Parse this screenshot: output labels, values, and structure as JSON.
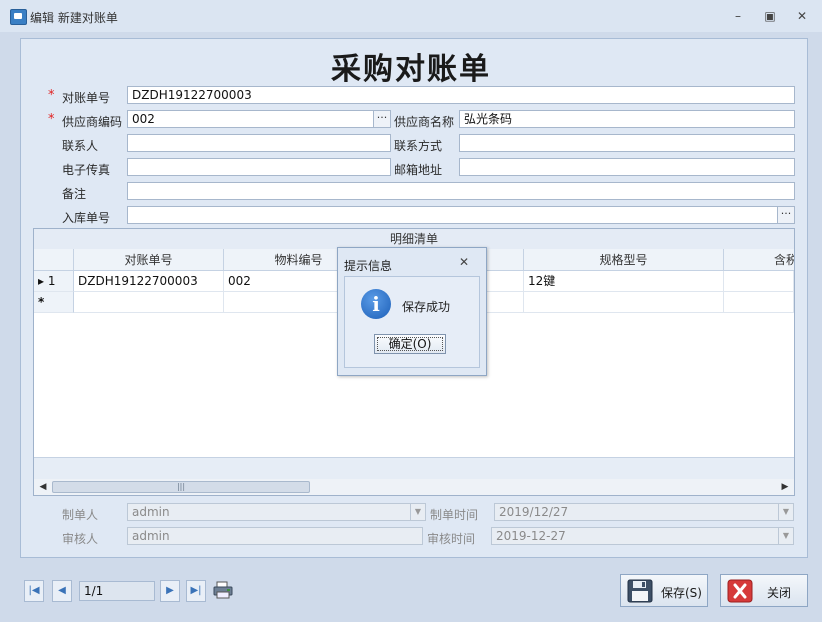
{
  "window": {
    "title": "编辑 新建对账单"
  },
  "form": {
    "title": "采购对账单",
    "fields": {
      "statement_no": {
        "label": "对账单号",
        "value": "DZDH19122700003",
        "required": true
      },
      "supplier_code": {
        "label": "供应商编码",
        "value": "002",
        "required": true
      },
      "supplier_name": {
        "label": "供应商名称",
        "value": "弘光条码"
      },
      "contact": {
        "label": "联系人",
        "value": ""
      },
      "contact_method": {
        "label": "联系方式",
        "value": ""
      },
      "fax": {
        "label": "电子传真",
        "value": ""
      },
      "email": {
        "label": "邮箱地址",
        "value": ""
      },
      "remark": {
        "label": "备注",
        "value": ""
      },
      "inbound_no": {
        "label": "入库单号",
        "value": ""
      }
    },
    "required_mark": "*",
    "ellipsis": "···"
  },
  "grid": {
    "group_title": "明细清单",
    "columns": [
      "对账单号",
      "物料编号",
      "",
      "规格型号",
      "含税"
    ],
    "rows": [
      {
        "indicator": "▸ 1",
        "cells": [
          "DZDH19122700003",
          "002",
          "",
          "12键",
          ""
        ]
      }
    ],
    "new_row_indicator": "*"
  },
  "footer": {
    "creator": {
      "label": "制单人",
      "value": "admin"
    },
    "create_time": {
      "label": "制单时间",
      "value": "2019/12/27"
    },
    "auditor": {
      "label": "审核人",
      "value": "admin"
    },
    "audit_time": {
      "label": "审核时间",
      "value": "2019-12-27"
    }
  },
  "nav": {
    "page": "1/1"
  },
  "buttons": {
    "save": "保存(S)",
    "close": "关闭"
  },
  "dialog": {
    "title": "提示信息",
    "message": "保存成功",
    "ok_label": "确定(O)"
  },
  "colors": {
    "accent": "#3a73b8",
    "required": "#e02020",
    "close_icon": "#d63a3a"
  }
}
